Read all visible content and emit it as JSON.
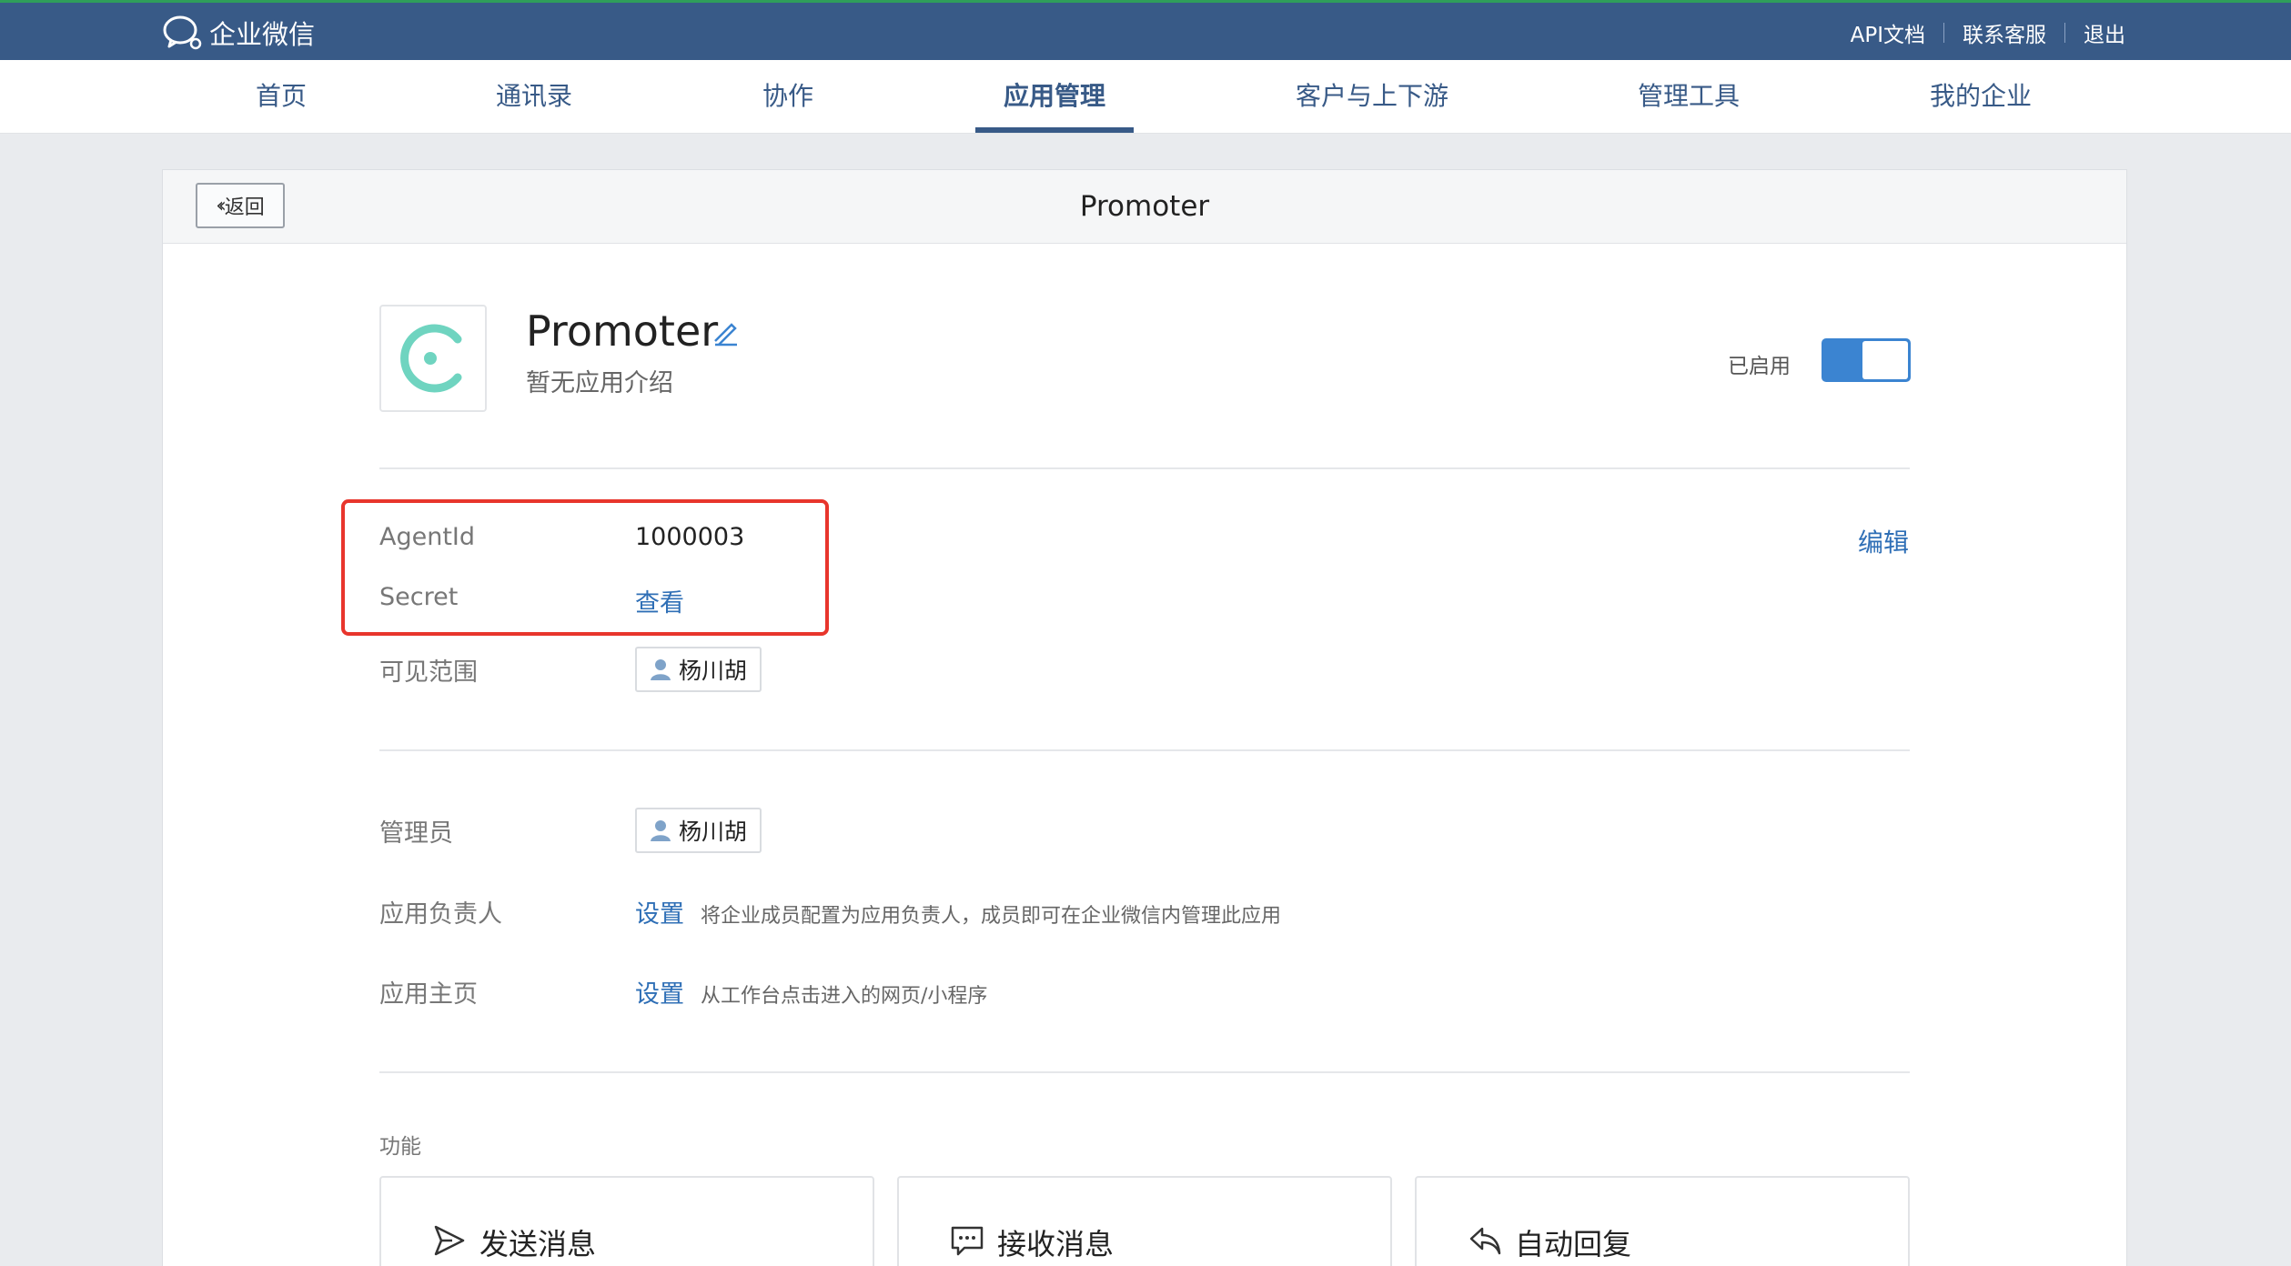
{
  "header": {
    "brand": "企业微信",
    "links": [
      "API文档",
      "联系客服",
      "退出"
    ]
  },
  "nav": {
    "items": [
      "首页",
      "通讯录",
      "协作",
      "应用管理",
      "客户与上下游",
      "管理工具",
      "我的企业"
    ],
    "active": "应用管理"
  },
  "panel": {
    "back_label": "返回",
    "title": "Promoter"
  },
  "app": {
    "name": "Promoter",
    "description": "暂无应用介绍",
    "status_label": "已启用",
    "enabled": true
  },
  "credentials": {
    "agentid_label": "AgentId",
    "agentid_value": "1000003",
    "secret_label": "Secret",
    "secret_link": "查看",
    "edit_label": "编辑"
  },
  "visibility": {
    "label": "可见范围",
    "member": "杨川胡"
  },
  "admin": {
    "label": "管理员",
    "member": "杨川胡"
  },
  "owner": {
    "label": "应用负责人",
    "action": "设置",
    "hint": "将企业成员配置为应用负责人，成员即可在企业微信内管理此应用"
  },
  "homepage": {
    "label": "应用主页",
    "action": "设置",
    "hint": "从工作台点击进入的网页/小程序"
  },
  "features": {
    "title": "功能",
    "cards": [
      {
        "label": "发送消息",
        "icon": "send-icon"
      },
      {
        "label": "接收消息",
        "icon": "message-icon"
      },
      {
        "label": "自动回复",
        "icon": "reply-icon"
      }
    ]
  },
  "colors": {
    "topbar": "#385a87",
    "accent": "#3b84d1",
    "link": "#2f6fb6",
    "highlight": "#e8352c",
    "logo": "#6fd4c0"
  }
}
